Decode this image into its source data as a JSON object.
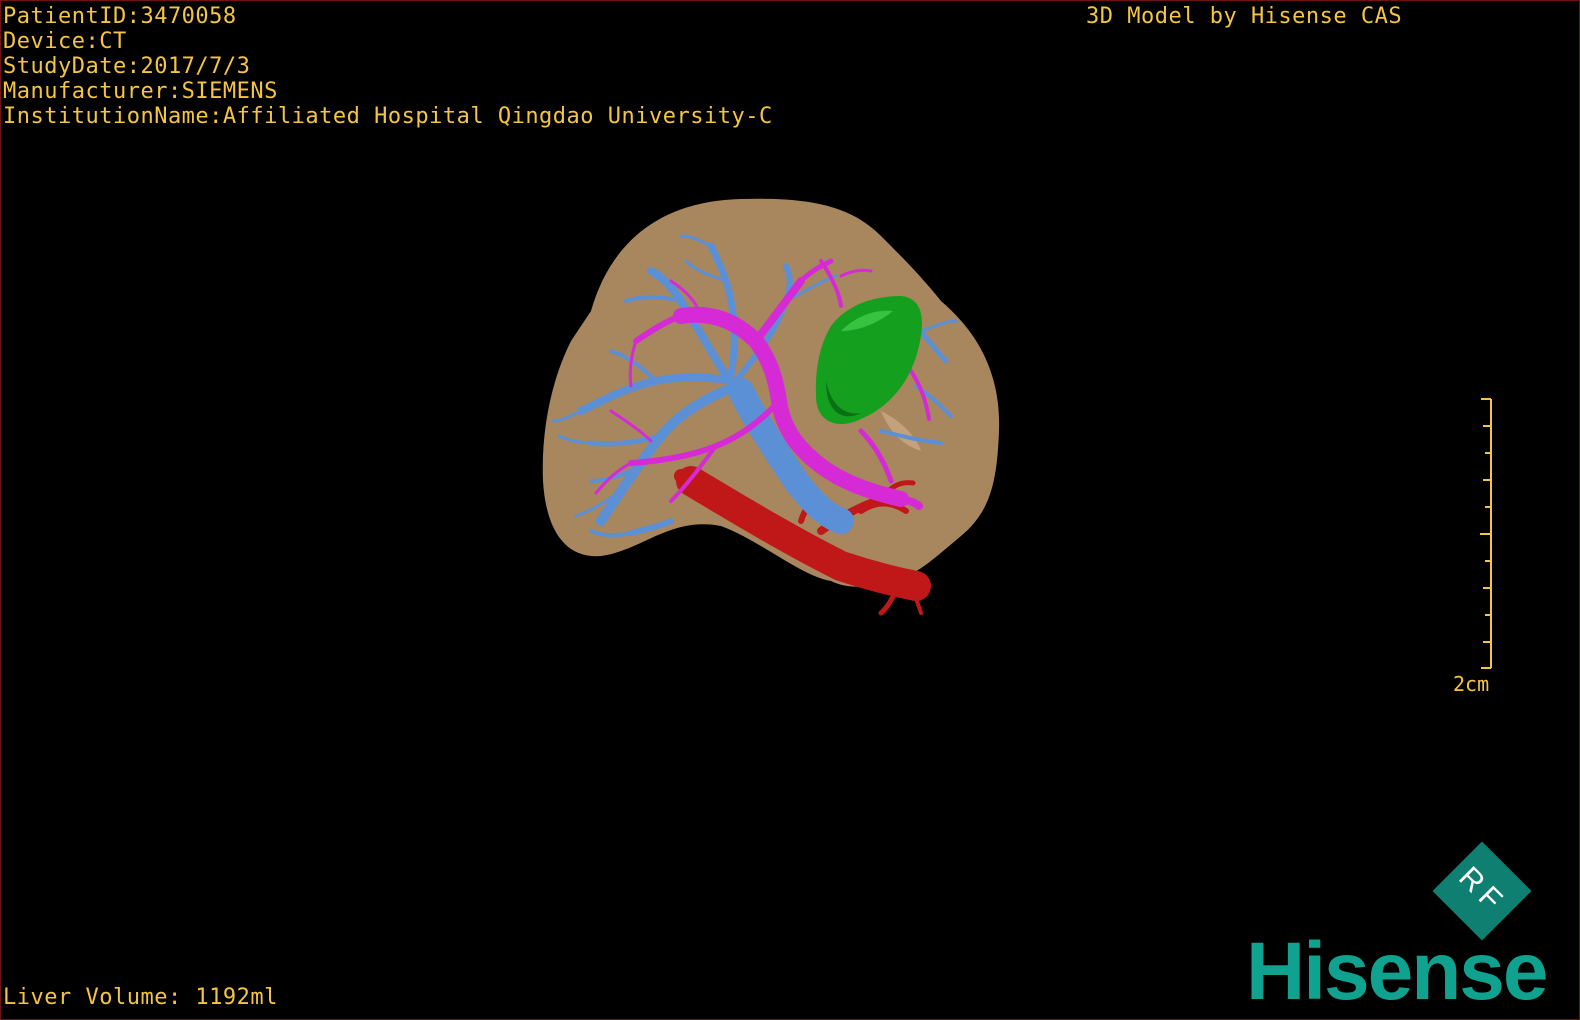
{
  "study_info": {
    "patient_id": "PatientID:3470058",
    "device": "Device:CT",
    "study_date": "StudyDate:2017/7/3",
    "manufacturer": "Manufacturer:SIEMENS",
    "institution": "InstitutionName:Affiliated Hospital Qingdao University-C"
  },
  "brand_line": "3D Model by Hisense CAS",
  "liver_volume": "Liver Volume: 1192ml",
  "scale": {
    "label": "2cm"
  },
  "badge": {
    "text": "RF"
  },
  "logo": {
    "text": "Hisense"
  },
  "colors": {
    "overlay_text": "#f5c542",
    "liver": "#a8875f",
    "portal_vein": "#5b8fd6",
    "hepatic_vein": "#d62ad6",
    "artery": "#c01818",
    "tumor": "#14a01e",
    "logo": "#0fa28e"
  },
  "icons": {
    "badge": "rf-diamond-icon",
    "scale": "scale-ruler-icon"
  }
}
